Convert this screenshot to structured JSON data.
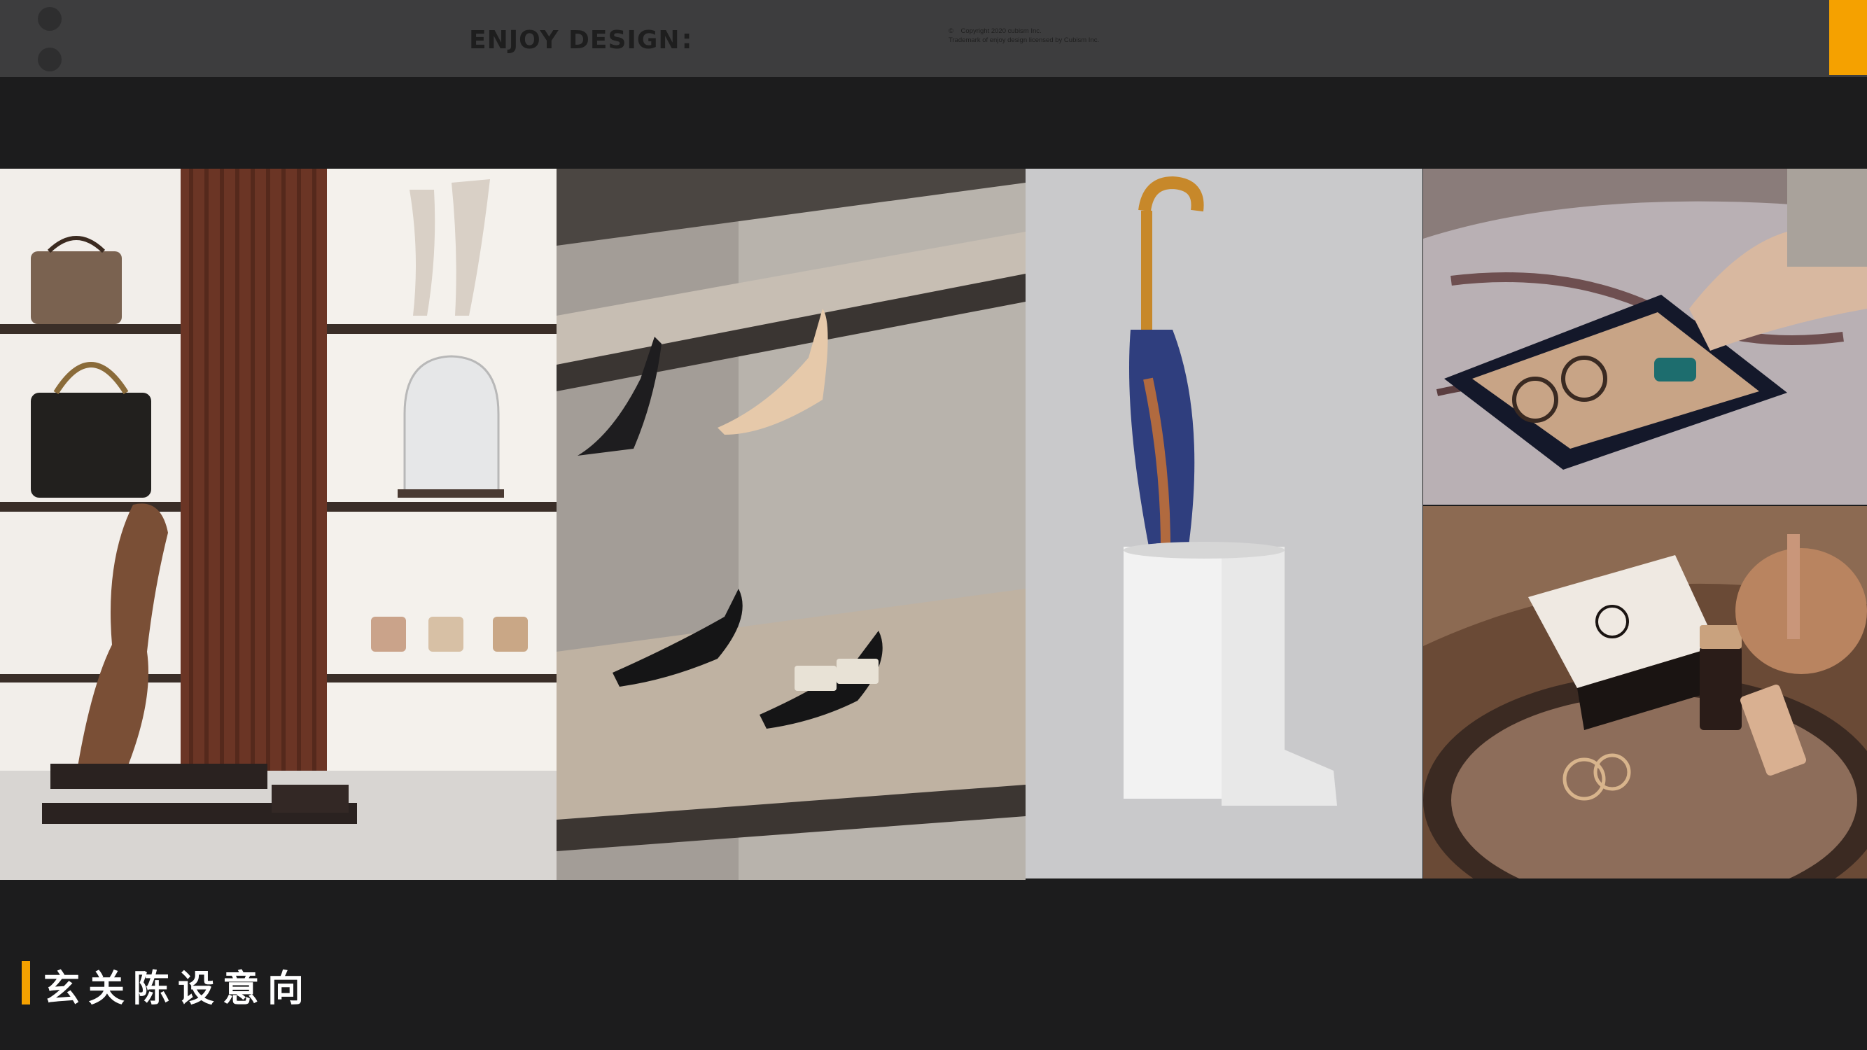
{
  "header": {
    "brand": "ENJOY DESIGN",
    "brand_mark": ":",
    "copyright_line1": "©    Copyright 2020 cubism Inc.",
    "copyright_line2": "Trademark of enjoy design licensed by Cubism Inc."
  },
  "colors": {
    "accent": "#f5a100",
    "background": "#1c1c1d",
    "header": "#3d3d3e"
  },
  "gallery": {
    "images": [
      {
        "subject": "boutique display shelves with handbags, hand sculptures and leopard figurine"
      },
      {
        "subject": "shoe shelves with heels and loafers"
      },
      {
        "subject": "white boot-shaped umbrella stand with umbrella"
      },
      {
        "subject": "valet tray with glasses, pen and keys on marble"
      },
      {
        "subject": "vanity tray with cosmetics, rings and lamp"
      }
    ]
  },
  "caption": {
    "title": "玄关陈设意向"
  }
}
